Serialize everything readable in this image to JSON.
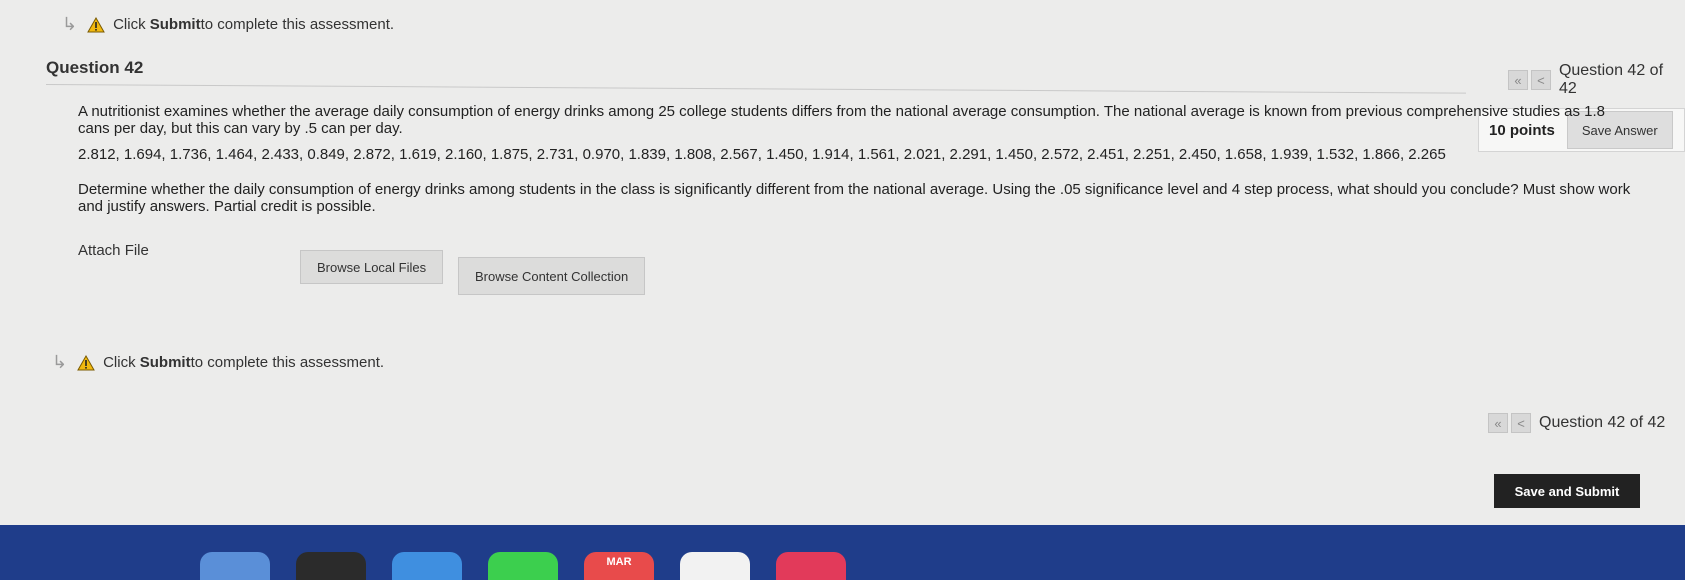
{
  "notice": {
    "prefix": "Click ",
    "bold": "Submit",
    "suffix": " to complete this assessment."
  },
  "question": {
    "title": "Question 42",
    "points": "10 points",
    "save_answer_label": "Save Answer",
    "paragraph1": "A nutritionist examines whether the average daily consumption of energy drinks among 25 college students differs from the national average consumption. The national average is known from previous comprehensive studies as 1.8 cans per day, but this can vary by .5 can per day.",
    "data_values": "2.812, 1.694, 1.736, 1.464, 2.433, 0.849, 2.872, 1.619, 2.160, 1.875, 2.731, 0.970, 1.839, 1.808, 2.567, 1.450, 1.914, 1.561, 2.021, 2.291, 1.450, 2.572, 2.451, 2.251, 2.450, 1.658, 1.939, 1.532, 1.866, 2.265",
    "paragraph2": "Determine whether the daily consumption of energy drinks among students in the class is significantly different from the national average. Using the .05 significance level and 4 step process, what should you conclude? Must show work and justify answers. Partial credit is possible.",
    "attach_label": "Attach File",
    "browse_local_label": "Browse Local Files",
    "browse_content_label": "Browse Content Collection"
  },
  "navigation": {
    "first_icon": "double-chevron-left-icon",
    "prev_icon": "chevron-left-icon",
    "first_glyph": "«",
    "prev_glyph": "<",
    "position_text": "Question 42 of 42"
  },
  "footer": {
    "submit_label": "Save and Submit"
  },
  "dock": {
    "calendar_month": "MAR"
  },
  "colors": {
    "warning": "#e8a000",
    "submit_bg": "#222222",
    "dock_bg": "#1f3d8a"
  }
}
